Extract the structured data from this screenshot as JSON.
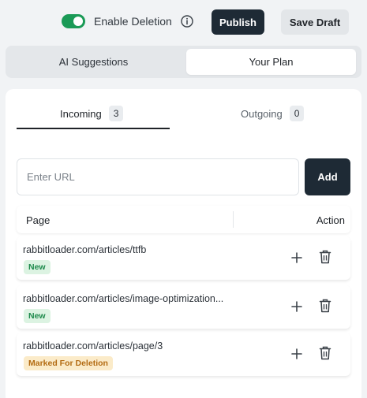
{
  "header": {
    "toggle_label": "Enable Deletion",
    "toggle_on": true,
    "publish_label": "Publish",
    "save_draft_label": "Save Draft"
  },
  "segments": [
    {
      "label": "AI Suggestions",
      "active": false
    },
    {
      "label": "Your Plan",
      "active": true
    }
  ],
  "tabs": {
    "incoming": {
      "label": "Incoming",
      "count": "3"
    },
    "outgoing": {
      "label": "Outgoing",
      "count": "0"
    }
  },
  "url_input": {
    "placeholder": "Enter URL",
    "value": ""
  },
  "add_button_label": "Add",
  "table": {
    "columns": {
      "page": "Page",
      "action": "Action"
    },
    "rows": [
      {
        "url": "rabbitloader.com/articles/ttfb",
        "badge": "New",
        "badge_type": "new"
      },
      {
        "url": "rabbitloader.com/articles/image-optimization...",
        "badge": "New",
        "badge_type": "new"
      },
      {
        "url": "rabbitloader.com/articles/page/3",
        "badge": "Marked For Deletion",
        "badge_type": "del"
      }
    ]
  },
  "colors": {
    "accent_green": "#1a9a56",
    "dark_button": "#1e2a35",
    "badge_new_bg": "#dcf3e2",
    "badge_delete_bg": "#fbebc9"
  },
  "icons": {
    "info": "info-icon",
    "plus": "plus-icon",
    "trash": "trash-icon"
  }
}
